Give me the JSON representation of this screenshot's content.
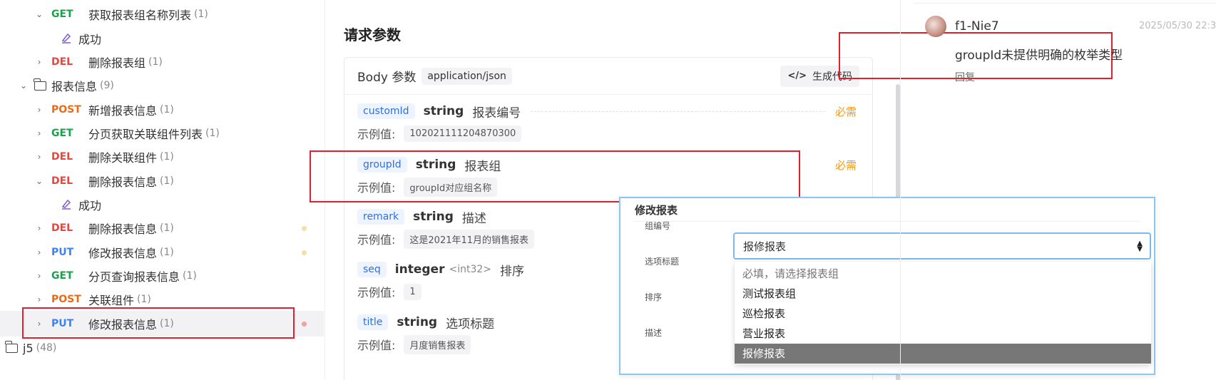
{
  "tree": {
    "rows": [
      {
        "chevron": "⌄",
        "method": "GET",
        "method_class": "m-get",
        "name": "获取报表组名称列表",
        "count": "(1)"
      },
      {
        "name": "成功",
        "type": "response"
      },
      {
        "chevron": "›",
        "method": "DEL",
        "method_class": "m-del",
        "name": "删除报表组",
        "count": "(1)"
      },
      {
        "chevron": "⌄",
        "name": "报表信息",
        "count": "(9)",
        "type": "folder"
      },
      {
        "chevron": "›",
        "method": "POST",
        "method_class": "m-post",
        "name": "新增报表信息",
        "count": "(1)"
      },
      {
        "chevron": "›",
        "method": "GET",
        "method_class": "m-get",
        "name": "分页获取关联组件列表",
        "count": "(1)"
      },
      {
        "chevron": "›",
        "method": "DEL",
        "method_class": "m-del",
        "name": "删除关联组件",
        "count": "(1)"
      },
      {
        "chevron": "⌄",
        "method": "DEL",
        "method_class": "m-del",
        "name": "删除报表信息",
        "count": "(1)"
      },
      {
        "name": "成功",
        "type": "response"
      },
      {
        "chevron": "›",
        "method": "DEL",
        "method_class": "m-del",
        "name": "删除报表信息",
        "count": "(1)",
        "dot": "#f6dfa0"
      },
      {
        "chevron": "›",
        "method": "PUT",
        "method_class": "m-put",
        "name": "修改报表信息",
        "count": "(1)",
        "dot": "#f6dfa0"
      },
      {
        "chevron": "›",
        "method": "GET",
        "method_class": "m-get",
        "name": "分页查询报表信息",
        "count": "(1)"
      },
      {
        "chevron": "›",
        "method": "POST",
        "method_class": "m-post",
        "name": "关联组件",
        "count": "(1)"
      },
      {
        "chevron": "›",
        "method": "PUT",
        "method_class": "m-put",
        "name": "修改报表信息",
        "count": "(1)",
        "dot": "#f2a0a0",
        "selected": true
      },
      {
        "name": "j5",
        "count": "(48)",
        "type": "folder"
      }
    ]
  },
  "request": {
    "section_title": "请求参数",
    "body_label": "Body 参数",
    "content_type": "application/json",
    "gen_code": "生成代码",
    "example_label": "示例值:",
    "required_label": "必需",
    "params": [
      {
        "name": "customId",
        "type": "string",
        "format": "",
        "desc": "报表编号",
        "required": true,
        "example": "102021111204870300"
      },
      {
        "name": "groupId",
        "type": "string",
        "format": "",
        "desc": "报表组",
        "required": true,
        "example": "groupId对应组名称"
      },
      {
        "name": "remark",
        "type": "string",
        "format": "",
        "desc": "描述",
        "required": false,
        "example": "这是2021年11月的销售报表"
      },
      {
        "name": "seq",
        "type": "integer",
        "format": "<int32>",
        "desc": "排序",
        "required": false,
        "example": "1"
      },
      {
        "name": "title",
        "type": "string",
        "format": "",
        "desc": "选项标题",
        "required": false,
        "example": "月度销售报表"
      }
    ]
  },
  "modal": {
    "title": "修改报表",
    "labels": {
      "group_no": "组编号",
      "option_title": "选项标题",
      "sort": "排序",
      "desc": "描述"
    },
    "select_value": "报修报表",
    "options": [
      {
        "label": "必填，请选择报表组",
        "placeholder": true
      },
      {
        "label": "测试报表组"
      },
      {
        "label": "巡检报表"
      },
      {
        "label": "营业报表"
      },
      {
        "label": "报修报表",
        "selected": true
      }
    ]
  },
  "comment": {
    "user": "f1-Nie7",
    "time": "2025/05/30 22:3",
    "text": "groupId未提供明确的枚举类型",
    "reply": "回复"
  },
  "colors": {
    "get": "#17a34a",
    "del": "#e5473c",
    "post": "#ea6a15",
    "put": "#3b82f6",
    "highlight": "#e0202e",
    "required": "#f29a1a"
  }
}
